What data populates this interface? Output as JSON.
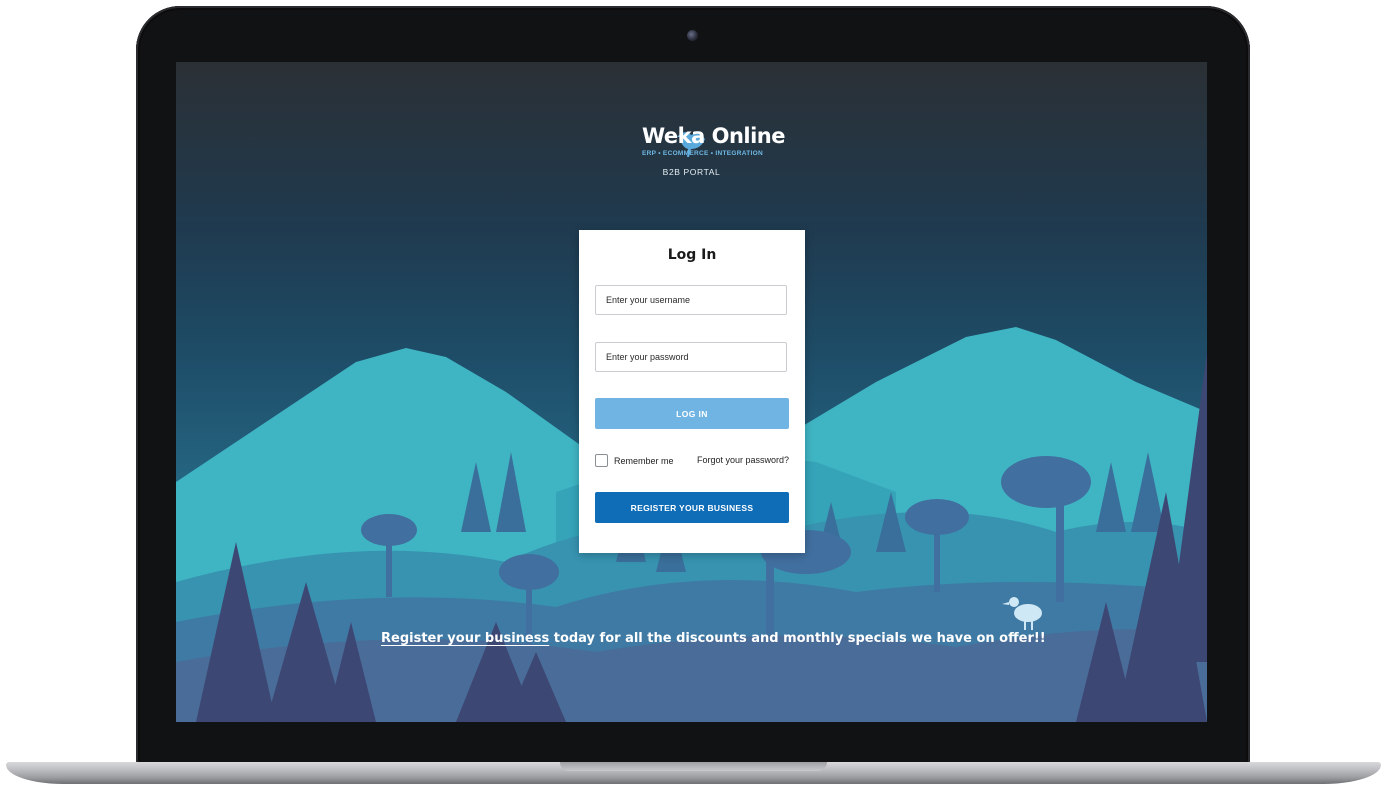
{
  "brand": {
    "name": "Weka Online",
    "tagline": "ERP • ECOMMERCE • INTEGRATION",
    "portal": "B2B PORTAL"
  },
  "login": {
    "title": "Log In",
    "username_placeholder": "Enter your username",
    "password_placeholder": "Enter your password",
    "login_label": "LOG IN",
    "remember_label": "Remember me",
    "forgot_label": "Forgot your password?",
    "register_label": "REGISTER YOUR BUSINESS"
  },
  "promo": {
    "link_text": "Register your business",
    "rest_text": " today for all the discounts and monthly specials we have on offer!!"
  },
  "colors": {
    "login_button": "#6fb4e2",
    "register_button": "#0f6cb6",
    "brand_accent": "#6fb9e6"
  }
}
